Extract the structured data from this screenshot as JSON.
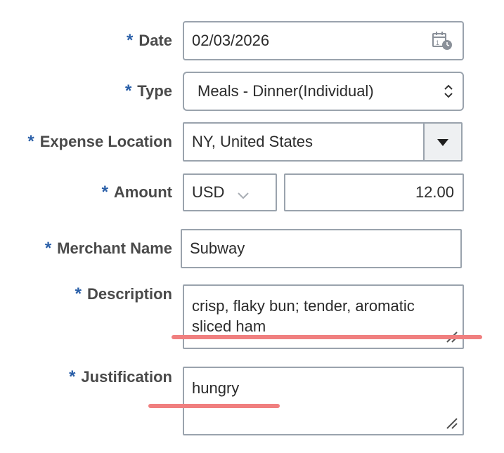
{
  "form": {
    "date": {
      "label": "Date",
      "value": "02/03/2026",
      "icon": "calendar-icon"
    },
    "type": {
      "label": "Type",
      "value": "Meals - Dinner(Individual)",
      "icon": "up-down-chevron-icon"
    },
    "expense_location": {
      "label": "Expense Location",
      "value": "NY, United States",
      "icon": "dropdown-triangle-icon"
    },
    "amount": {
      "label": "Amount",
      "currency": "USD",
      "value": "12.00",
      "icon": "chevron-down-icon"
    },
    "merchant_name": {
      "label": "Merchant Name",
      "value": "Subway"
    },
    "description": {
      "label": "Description",
      "value": "crisp, flaky bun; tender, aromatic sliced ham"
    },
    "justification": {
      "label": "Justification",
      "value": "hungry"
    },
    "required_marker": "*"
  },
  "colors": {
    "required_marker": "#2a5fa8",
    "field_border": "#9aa3ad",
    "annotation_underline": "#f07f7f"
  }
}
